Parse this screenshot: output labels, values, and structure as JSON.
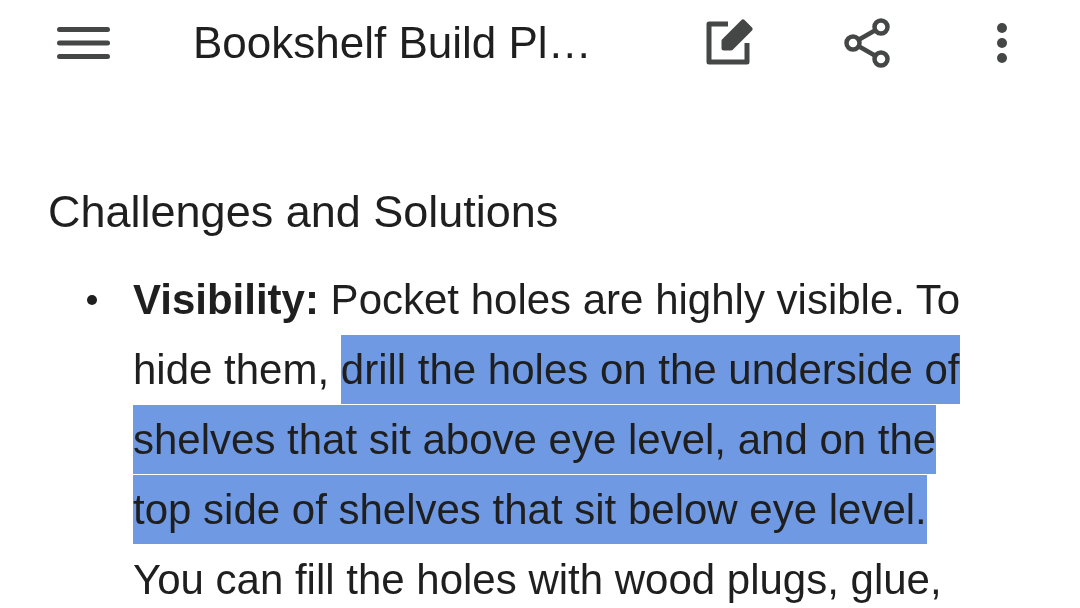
{
  "app_bar": {
    "title": "Bookshelf Build Pl…"
  },
  "document": {
    "heading": "Challenges and Solutions",
    "bullets": [
      {
        "segments": [
          {
            "text": "**Visibility:** Pocket holes are highly visible. To hide them,",
            "selected": false
          },
          {
            "text": "drill the holes on the underside of shelves that sit above eye level, and on the top side of shelves that sit below eye level.",
            "selected": true
          },
          {
            "text": "You can fill the holes with wood plugs, glue,",
            "selected": false
          }
        ]
      }
    ]
  }
}
